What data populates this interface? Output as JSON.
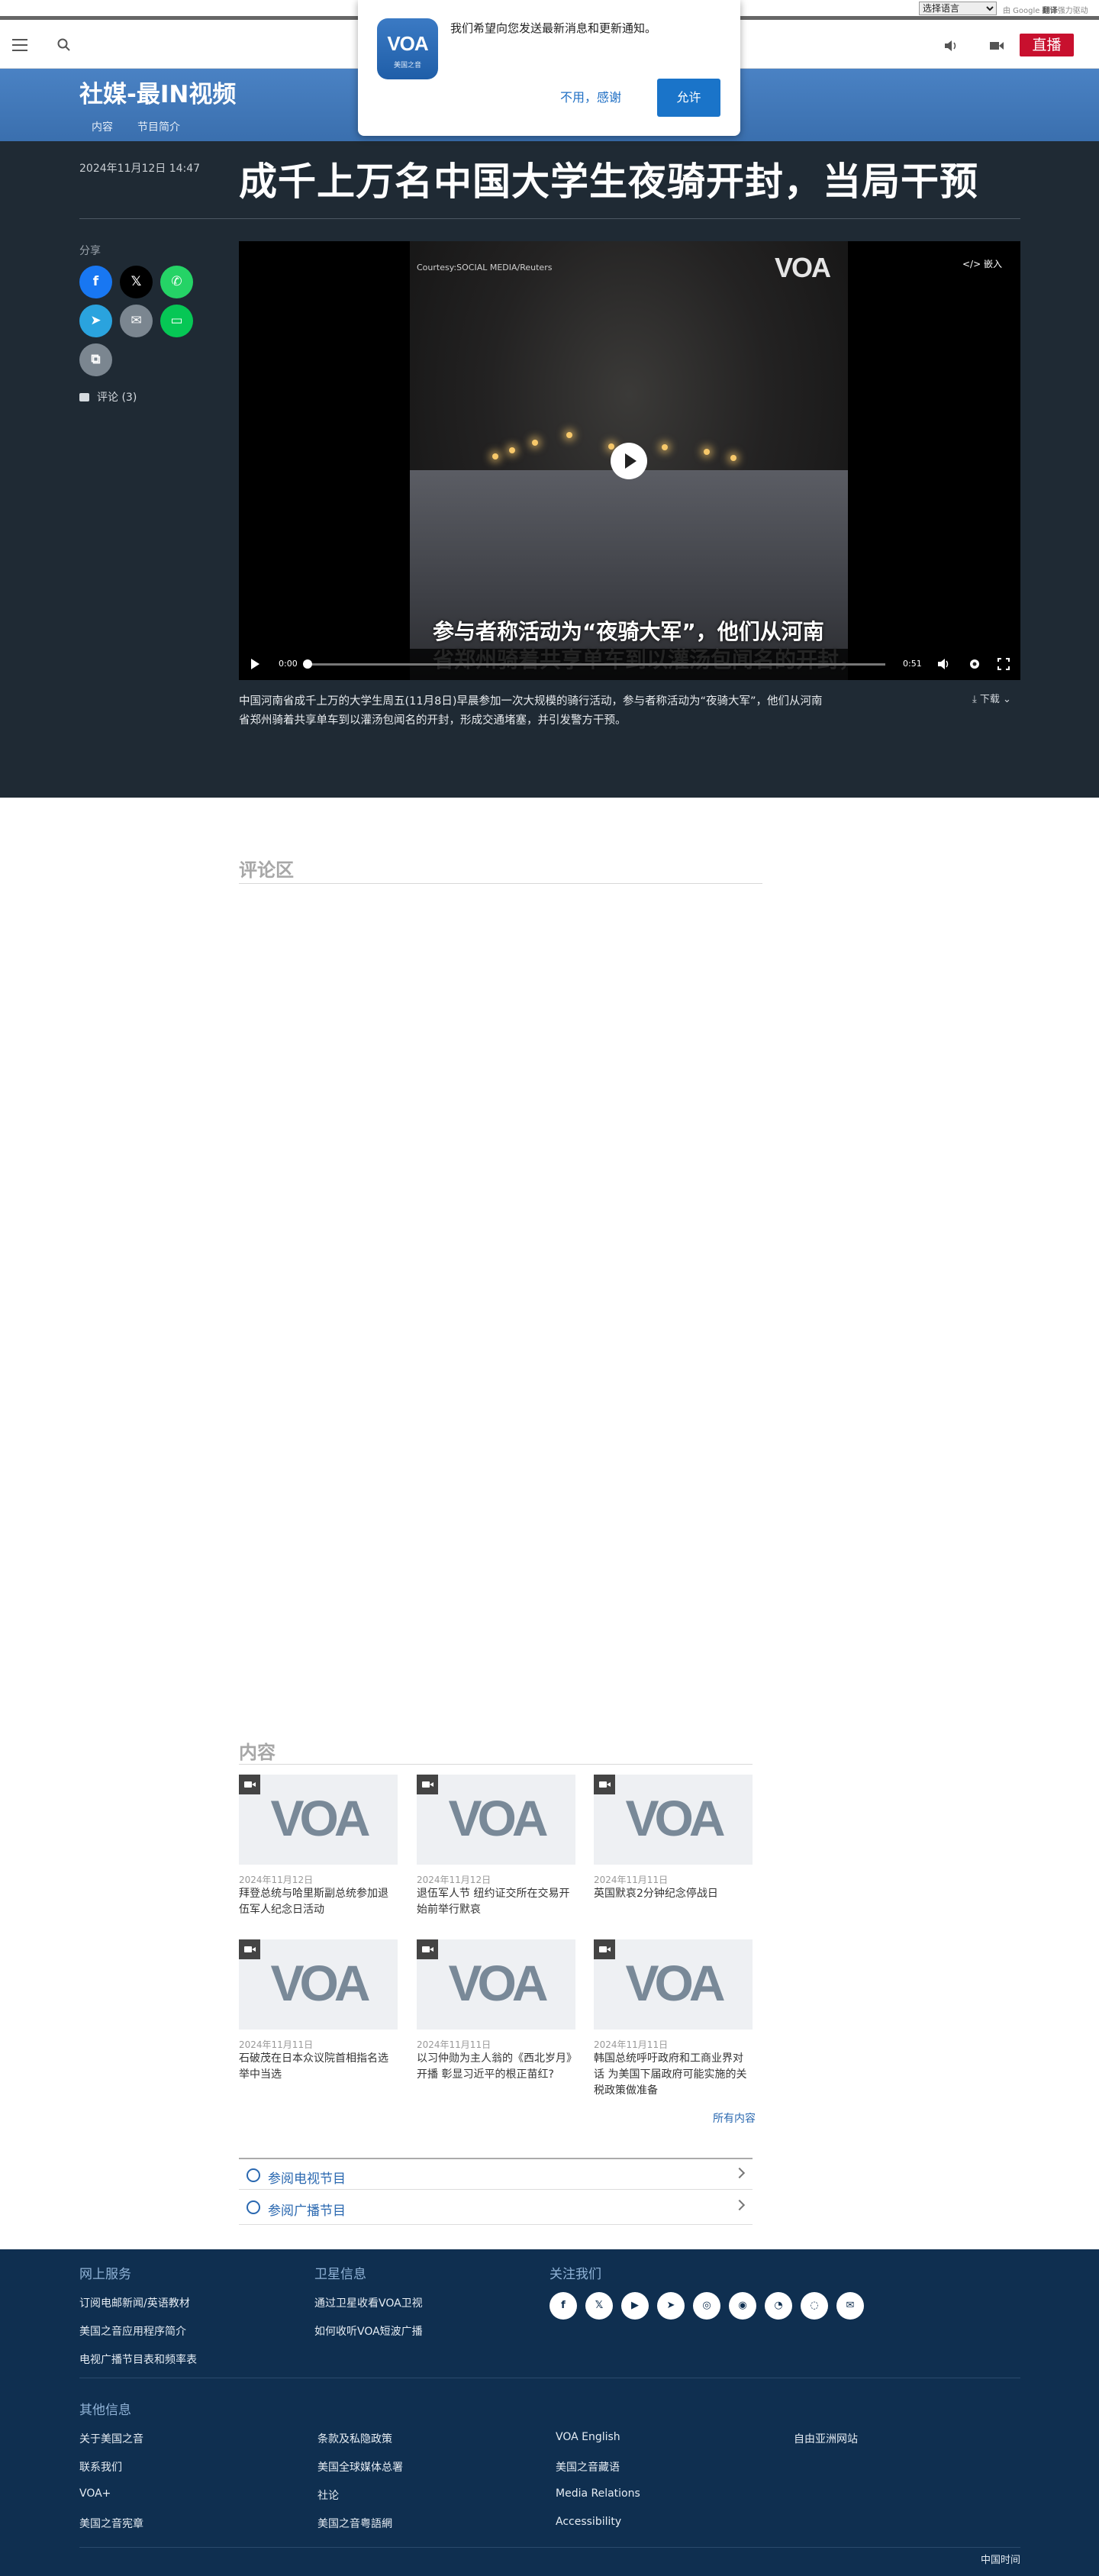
{
  "top_strip": {
    "language_select": "选择语言",
    "translate_credit_prefix": "由 Google",
    "translate_credit_bold": "翻译",
    "translate_credit_suffix": "强力驱动"
  },
  "header": {
    "live_label": "直播"
  },
  "notification": {
    "message": "我们希望向您发送最新消息和更新通知。",
    "logo_text": "VOA",
    "logo_subtext": "美国之音",
    "deny_label": "不用，感谢",
    "allow_label": "允许"
  },
  "program": {
    "title": "社媒-最IN视频",
    "nav": [
      "内容",
      "节目简介"
    ]
  },
  "article": {
    "date": "2024年11月12日 14:47",
    "title": "成千上万名中国大学生夜骑开封，当局干预",
    "share_label": "分享",
    "comments_label": "评论 (3)",
    "caption": "中国河南省成千上万的大学生周五(11月8日)早晨参加一次大规模的骑行活动，参与者称活动为“夜骑大军”，他们从河南省郑州骑着共享单车到以灌汤包闻名的开封，形成交通堵塞，并引发警方干预。",
    "download_label": "下载"
  },
  "share_buttons": [
    {
      "name": "facebook",
      "glyph": "f",
      "color": "#1877f2"
    },
    {
      "name": "x",
      "glyph": "𝕏",
      "color": "#000000"
    },
    {
      "name": "whatsapp",
      "glyph": "✆",
      "color": "#25d366"
    },
    {
      "name": "telegram",
      "glyph": "➤",
      "color": "#2aa3de"
    },
    {
      "name": "email",
      "glyph": "✉",
      "color": "#7b8690"
    },
    {
      "name": "line",
      "glyph": "▭",
      "color": "#06c755"
    },
    {
      "name": "copy-link",
      "glyph": "⧉",
      "color": "#7b8690"
    }
  ],
  "video": {
    "credit": "Courtesy:SOCIAL MEDIA/Reuters",
    "watermark": "VOA",
    "embed_label": "嵌入",
    "subtitle_line1": "参与者称活动为“夜骑大军”，他们从河南",
    "subtitle_line2": "省郑州骑着共享单车到以灌汤包闻名的开封，",
    "current_time": "0:00",
    "duration": "0:51",
    "progress_fraction": 0.0
  },
  "comments": {
    "heading": "评论区"
  },
  "content": {
    "heading": "内容",
    "cards": [
      {
        "date": "2024年11月12日",
        "title": "拜登总统与哈里斯副总统参加退伍军人纪念日活动"
      },
      {
        "date": "2024年11月12日",
        "title": "退伍军人节 纽约证交所在交易开始前举行默哀"
      },
      {
        "date": "2024年11月11日",
        "title": "英国默哀2分钟纪念停战日"
      },
      {
        "date": "2024年11月11日",
        "title": "石破茂在日本众议院首相指名选举中当选"
      },
      {
        "date": "2024年11月11日",
        "title": "以习仲勋为主人翁的《西北岁月》开播 彰显习近平的根正苗红?"
      },
      {
        "date": "2024年11月11日",
        "title": "韩国总统呼吁政府和工商业界对话 为美国下届政府可能实施的关税政策做准备"
      }
    ],
    "all_content_link": "所有内容",
    "tv_schedule": "参阅电视节目",
    "radio_schedule": "参阅广播节目"
  },
  "footer": {
    "online_services_heading": "网上服务",
    "online_services": [
      "订阅电邮新闻/英语教材",
      "美国之音应用程序简介",
      "电视广播节目表和频率表"
    ],
    "satellite_heading": "卫星信息",
    "satellite": [
      "通过卫星收看VOA卫视",
      "如何收听VOA短波广播"
    ],
    "follow_heading": "关注我们",
    "social_icons": [
      "facebook-icon",
      "x-icon",
      "youtube-icon",
      "telegram-icon",
      "instagram-icon",
      "podcast-icon",
      "rss-icon",
      "signal-icon",
      "email-icon"
    ],
    "social_glyphs": [
      "f",
      "𝕏",
      "▶",
      "➤",
      "◎",
      "◉",
      "◔",
      "◌",
      "✉"
    ],
    "other_heading": "其他信息",
    "other_col1": [
      "关于美国之音",
      "联系我们",
      "VOA+",
      "美国之音宪章"
    ],
    "other_col2": [
      "条款及私隐政策",
      "美国全球媒体总署",
      "社论",
      "美国之音粤語網"
    ],
    "other_col3": [
      "VOA English",
      "美国之音藏语",
      "Media Relations",
      "Accessibility"
    ],
    "other_col4": [
      "自由亚洲网站"
    ],
    "china_time": "中国时间"
  }
}
